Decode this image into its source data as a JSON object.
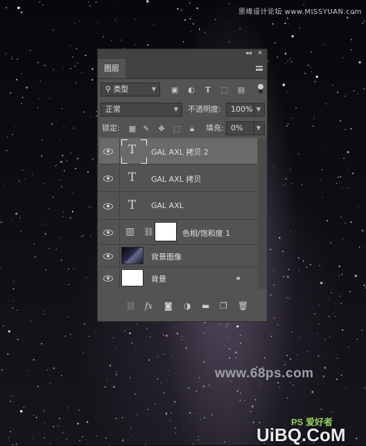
{
  "watermarks": {
    "top": "思缘设计论坛 www.MISSYUAN.com",
    "middle": "www.68ps.com",
    "logo": "UiBQ.CoM",
    "logo_small": "PS 爱好者"
  },
  "panel": {
    "tab_label": "图层",
    "filter": {
      "icon": "search-icon",
      "value": "类型"
    },
    "filter_icons": [
      "image-filter-icon",
      "adjustment-filter-icon",
      "type-filter-icon",
      "shape-filter-icon",
      "smart-object-filter-icon"
    ],
    "blend_mode": "正常",
    "opacity_label": "不透明度:",
    "opacity_value": "100%",
    "lock_label": "锁定:",
    "fill_label": "填充:",
    "fill_value": "0%",
    "layers": [
      {
        "name": "GAL AXL 拷贝 2",
        "kind": "text",
        "selected": true
      },
      {
        "name": "GAL AXL 拷贝",
        "kind": "text"
      },
      {
        "name": "GAL AXL",
        "kind": "text"
      },
      {
        "name": "色相/饱和度 1",
        "kind": "adjustment"
      },
      {
        "name": "背景图像",
        "kind": "image"
      },
      {
        "name": "背景",
        "kind": "background",
        "locked": true
      }
    ]
  },
  "colors": {
    "panel_bg": "#535353",
    "selected_row": "#6a6a6a",
    "tab_bar": "#424242"
  }
}
